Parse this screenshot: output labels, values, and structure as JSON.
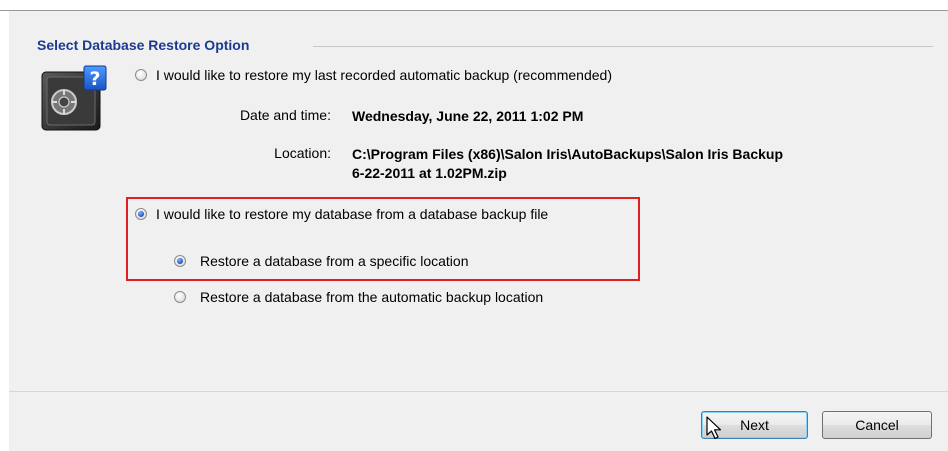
{
  "section_title": "Select Database Restore Option",
  "icon": "safe-question-icon",
  "options": {
    "auto_last": {
      "label": "I would like to restore my last recorded automatic backup (recommended)",
      "checked": false,
      "date_label": "Date and time:",
      "date_value": "Wednesday, June 22, 2011 1:02 PM",
      "location_label": "Location:",
      "location_value_line1": "C:\\Program Files (x86)\\Salon Iris\\AutoBackups\\Salon Iris Backup",
      "location_value_line2": "6-22-2011 at 1.02PM.zip"
    },
    "from_file": {
      "label": "I would like to restore my database from a database backup file",
      "checked": true
    },
    "specific_location": {
      "label": "Restore a database from a specific location",
      "checked": true
    },
    "automatic_location": {
      "label": "Restore a database from the automatic backup location",
      "checked": false
    }
  },
  "buttons": {
    "next": "Next",
    "cancel": "Cancel"
  },
  "colors": {
    "title": "#1c3a91",
    "highlight": "#e02020",
    "panel": "#f0f0f0"
  }
}
